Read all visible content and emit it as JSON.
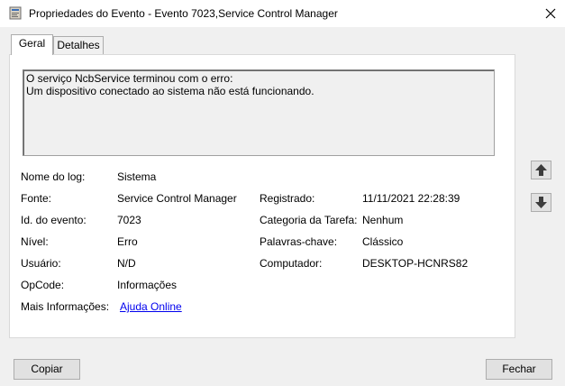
{
  "window": {
    "title": "Propriedades do Evento - Evento 7023,Service Control Manager",
    "icon": "event-properties-icon",
    "close_icon": "close-icon"
  },
  "tabs": [
    {
      "label": "Geral",
      "selected": true
    },
    {
      "label": "Detalhes",
      "selected": false
    }
  ],
  "message": {
    "lines": [
      "O serviço NcbService terminou com o erro:",
      "Um dispositivo conectado ao sistema não está funcionando."
    ]
  },
  "fields": {
    "log_name": {
      "label": "Nome do log:",
      "value": "Sistema"
    },
    "source": {
      "label": "Fonte:",
      "value": "Service Control Manager"
    },
    "logged": {
      "label": "Registrado:",
      "value": "11/11/2021 22:28:39"
    },
    "event_id": {
      "label": "Id. do evento:",
      "value": "7023"
    },
    "task_category": {
      "label": "Categoria da Tarefa:",
      "value": "Nenhum"
    },
    "level": {
      "label": "Nível:",
      "value": "Erro"
    },
    "keywords": {
      "label": "Palavras-chave:",
      "value": "Clássico"
    },
    "user": {
      "label": "Usuário:",
      "value": "N/D"
    },
    "computer": {
      "label": "Computador:",
      "value": "DESKTOP-HCNRS82"
    },
    "opcode": {
      "label": "OpCode:",
      "value": "Informações"
    },
    "more_info": {
      "label": "Mais Informações:",
      "link": "Ajuda Online"
    }
  },
  "nav": {
    "up_icon": "arrow-up-icon",
    "down_icon": "arrow-down-icon"
  },
  "buttons": {
    "copy": "Copiar",
    "close": "Fechar"
  }
}
